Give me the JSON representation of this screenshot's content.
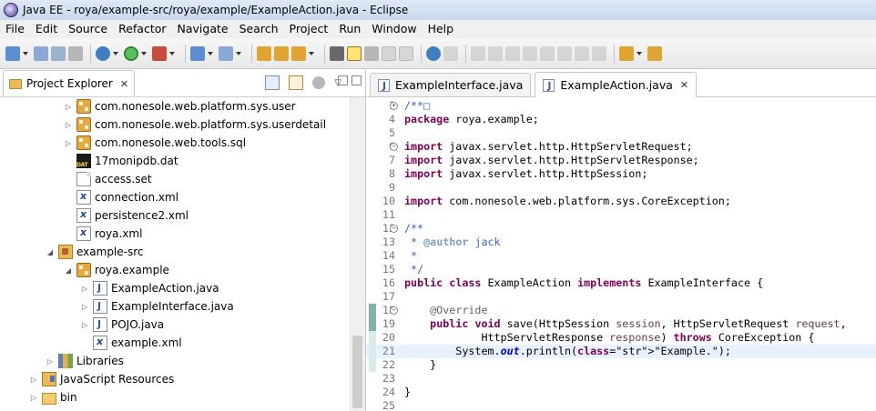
{
  "window": {
    "title": "Java EE - roya/example-src/roya/example/ExampleAction.java - Eclipse"
  },
  "menubar": {
    "items": [
      "File",
      "Edit",
      "Source",
      "Refactor",
      "Navigate",
      "Search",
      "Project",
      "Run",
      "Window",
      "Help"
    ]
  },
  "toolbar": {
    "buttons": [
      "new-icon",
      "save-icon",
      "save-all-icon",
      "print-icon",
      "debug-icon",
      "run-icon",
      "external-tools-icon",
      "new-java-project-icon",
      "new-package-icon",
      "open-type-icon",
      "search-icon",
      "toggle-breadcrumb-icon",
      "toggle-mark-occurrences-icon",
      "show-whitespace-icon",
      "block-selection-icon",
      "skip-breakpoints-icon",
      "resume-icon",
      "suspend-icon",
      "terminate-icon",
      "step-into-icon",
      "step-over-icon",
      "step-return-icon",
      "back-icon",
      "forward-icon"
    ]
  },
  "explorer": {
    "title": "Project Explorer",
    "tree": [
      {
        "label": "com.nonesole.web.platform.sys.user",
        "icon": "package-icon",
        "twisty": "▷"
      },
      {
        "label": "com.nonesole.web.platform.sys.userdetail",
        "icon": "package-icon",
        "twisty": "▷"
      },
      {
        "label": "com.nonesole.web.tools.sql",
        "icon": "package-icon",
        "twisty": "▷"
      },
      {
        "label": "17monipdb.dat",
        "icon": "dat-file-icon",
        "twisty": ""
      },
      {
        "label": "access.set",
        "icon": "file-icon",
        "twisty": ""
      },
      {
        "label": "connection.xml",
        "icon": "xml-file-icon",
        "twisty": ""
      },
      {
        "label": "persistence2.xml",
        "icon": "xml-file-icon",
        "twisty": ""
      },
      {
        "label": "roya.xml",
        "icon": "xml-file-icon",
        "twisty": ""
      },
      {
        "label": "example-src",
        "icon": "source-folder-icon",
        "twisty": "◢"
      },
      {
        "label": "roya.example",
        "icon": "package-icon",
        "twisty": "◢"
      },
      {
        "label": "ExampleAction.java",
        "icon": "java-file-icon",
        "twisty": "▷"
      },
      {
        "label": "ExampleInterface.java",
        "icon": "java-file-icon",
        "twisty": "▷"
      },
      {
        "label": "POJO.java",
        "icon": "java-file-icon",
        "twisty": "▷"
      },
      {
        "label": "example.xml",
        "icon": "xml-file-icon",
        "twisty": ""
      },
      {
        "label": "Libraries",
        "icon": "libraries-icon",
        "twisty": "▷"
      },
      {
        "label": "JavaScript Resources",
        "icon": "javascript-resources-icon",
        "twisty": "▷"
      },
      {
        "label": "bin",
        "icon": "folder-icon",
        "twisty": "▷"
      }
    ]
  },
  "editor": {
    "tabs": [
      {
        "label": "ExampleInterface.java",
        "active": false
      },
      {
        "label": "ExampleAction.java",
        "active": true
      }
    ],
    "lines": [
      {
        "n": "1",
        "fold": "+",
        "html": "/**□"
      },
      {
        "n": "4",
        "fold": "",
        "html": "package roya.example;"
      },
      {
        "n": "5",
        "fold": "",
        "html": ""
      },
      {
        "n": "6",
        "fold": "-",
        "html": "import javax.servlet.http.HttpServletRequest;"
      },
      {
        "n": "7",
        "fold": "",
        "html": "import javax.servlet.http.HttpServletResponse;"
      },
      {
        "n": "8",
        "fold": "",
        "html": "import javax.servlet.http.HttpSession;"
      },
      {
        "n": "9",
        "fold": "",
        "html": ""
      },
      {
        "n": "10",
        "fold": "",
        "html": "import com.nonesole.web.platform.sys.CoreException;"
      },
      {
        "n": "11",
        "fold": "",
        "html": ""
      },
      {
        "n": "12",
        "fold": "-",
        "html": "/**"
      },
      {
        "n": "13",
        "fold": "",
        "html": " * @author jack"
      },
      {
        "n": "14",
        "fold": "",
        "html": " *"
      },
      {
        "n": "15",
        "fold": "",
        "html": " */"
      },
      {
        "n": "16",
        "fold": "",
        "html": "public class ExampleAction implements ExampleInterface {"
      },
      {
        "n": "17",
        "fold": "",
        "html": ""
      },
      {
        "n": "18",
        "fold": "-",
        "html": "    @Override"
      },
      {
        "n": "19",
        "fold": "",
        "html": "    public void save(HttpSession session, HttpServletRequest request,"
      },
      {
        "n": "20",
        "fold": "",
        "html": "            HttpServletResponse response) throws CoreException {"
      },
      {
        "n": "21",
        "fold": "",
        "html": "        System.out.println(\"Example.\");"
      },
      {
        "n": "22",
        "fold": "",
        "html": "    }"
      },
      {
        "n": "23",
        "fold": "",
        "html": ""
      },
      {
        "n": "24",
        "fold": "",
        "html": "}"
      },
      {
        "n": "25",
        "fold": "",
        "html": ""
      }
    ]
  }
}
